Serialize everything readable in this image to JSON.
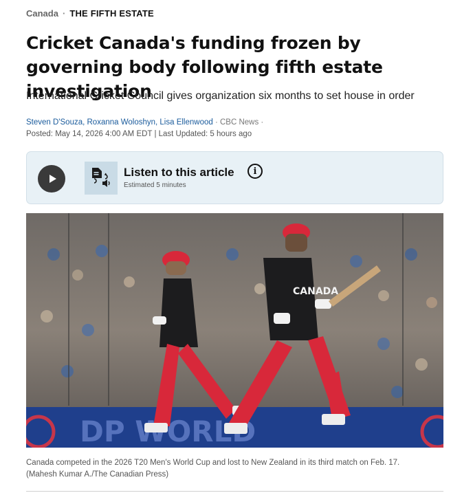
{
  "kicker": {
    "section": "Canada",
    "separator": "·",
    "show": "THE FIFTH ESTATE"
  },
  "headline": "Cricket Canada's funding frozen by governing body following fifth estate investigation",
  "deck": "International Cricket Council gives organization six months to set house in order",
  "byline": {
    "authors": "Steven D'Souza, Roxanna Woloshyn, Lisa Ellenwood",
    "outlet": "· CBC News ·",
    "dates": "Posted: May 14, 2026 4:00 AM EDT | Last Updated: 5 hours ago"
  },
  "listen": {
    "title": "Listen to this article",
    "estimate": "Estimated 5 minutes",
    "info_glyph": "i",
    "icons": [
      "play-icon",
      "text-to-speech-icon",
      "info-icon"
    ]
  },
  "photo": {
    "banner_text": "DP WORLD",
    "jersey_text": "CANADA",
    "colors": {
      "jersey": "#1c1c1e",
      "pads": "#d8283a",
      "helmet": "#d8283a",
      "banner": "#1f3f8c"
    }
  },
  "caption": {
    "text": "Canada competed in the 2026 T20 Men's World Cup and lost to New Zealand in its third match on Feb. 17.",
    "credit": "(Mahesh Kumar A./The Canadian Press)"
  },
  "colors": {
    "link": "#1a5b9c",
    "listen_bg": "#e8f1f6"
  }
}
